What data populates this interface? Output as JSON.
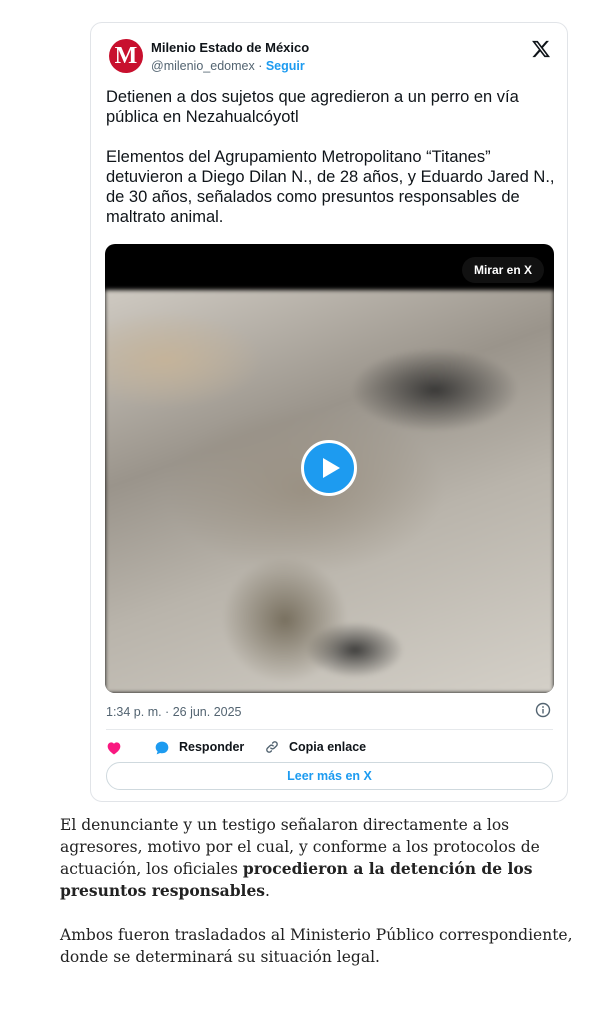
{
  "tweet": {
    "author_name": "Milenio Estado de México",
    "avatar_letter": "M",
    "handle": "@milenio_edomex",
    "separator": " · ",
    "follow_label": "Seguir",
    "text_paragraph_1": "Detienen a dos sujetos que agredieron a un perro en vía pública en Nezahualcóyotl",
    "text_paragraph_2": "Elementos del Agrupamiento Metropolitano “Titanes” detuvieron a Diego Dilan N., de 28 años, y Eduardo Jared N., de 30 años, señalados como presuntos responsables de maltrato animal.",
    "watch_button_label": "Mirar en X",
    "timestamp": "1:34 p. m. · 26 jun. 2025",
    "reply_label": "Responder",
    "copy_link_label": "Copia enlace",
    "read_more_label": "Leer más en X",
    "icons": {
      "x_logo": "x-logo-icon",
      "play": "play-icon",
      "info": "info-icon",
      "heart": "heart-icon",
      "reply": "reply-icon",
      "link": "link-icon"
    },
    "colors": {
      "accent": "#1d9bf0",
      "heart": "#f91880",
      "avatar": "#c8102e"
    }
  },
  "article": {
    "p1_text": "El denunciante y un testigo señalaron directamente a los agresores, motivo por el cual, y conforme a los protocolos de actuación, los oficiales ",
    "p1_bold": "procedieron a la detención de los presuntos responsables",
    "p1_end": ".",
    "p2_text": "Ambos fueron trasladados al Ministerio Público correspondiente, donde se determinará su situación legal."
  }
}
